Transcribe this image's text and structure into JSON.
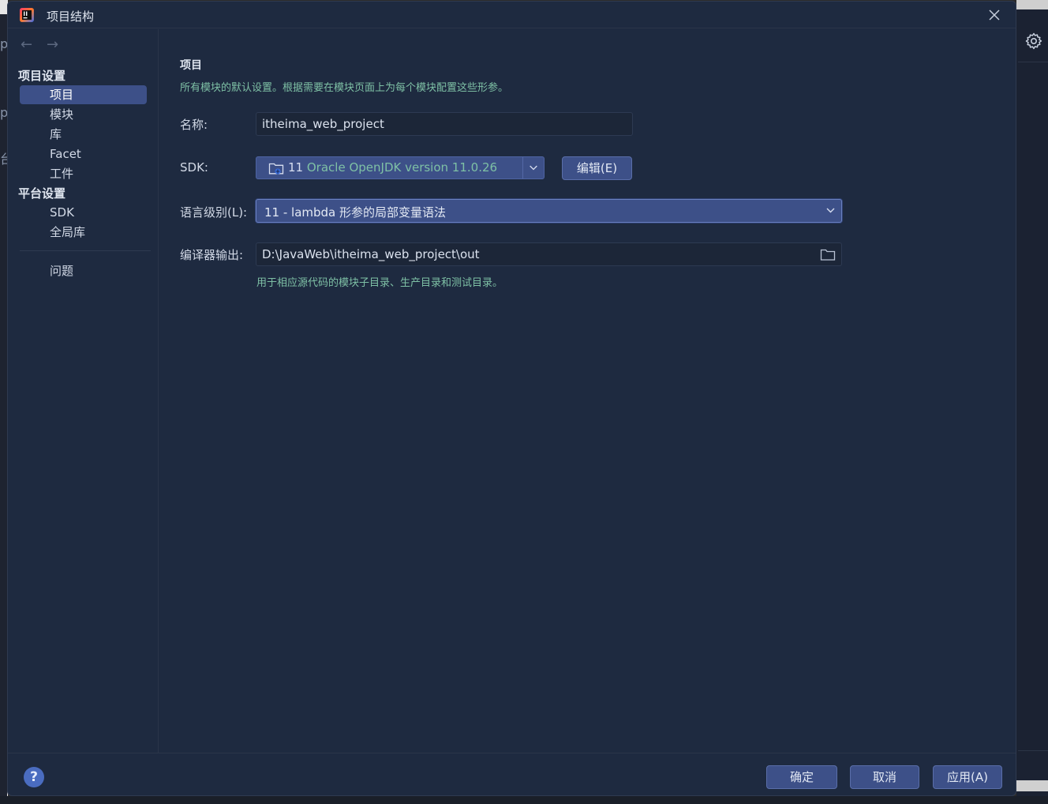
{
  "dialog": {
    "title": "项目结构"
  },
  "background": {
    "left_glyph_1": "p",
    "left_glyph_2": "p",
    "left_glyph_3": "台"
  },
  "sidebar": {
    "back_icon": "←",
    "forward_icon": "→",
    "project_settings_header": "项目设置",
    "project_items": [
      "项目",
      "模块",
      "库",
      "Facet",
      "工件"
    ],
    "platform_settings_header": "平台设置",
    "platform_items": [
      "SDK",
      "全局库"
    ],
    "problems": "问题",
    "selected_index": 0
  },
  "content": {
    "title": "项目",
    "description": "所有模块的默认设置。根据需要在模块页面上为每个模块配置这些形参。",
    "name_label": "名称:",
    "name_value": "itheima_web_project",
    "sdk_label": "SDK:",
    "sdk_version": "11",
    "sdk_name": "Oracle OpenJDK version 11.0.26",
    "edit_button": "编辑(E)",
    "language_level_label": "语言级别(L):",
    "language_level_value": "11 - lambda 形参的局部变量语法",
    "compiler_output_label": "编译器输出:",
    "compiler_output_value": "D:\\JavaWeb\\itheima_web_project\\out",
    "compiler_output_hint": "用于相应源代码的模块子目录、生产目录和测试目录。"
  },
  "footer": {
    "help_icon": "?",
    "ok_button": "确定",
    "cancel_button": "取消",
    "apply_button": "应用(A)"
  },
  "colors": {
    "dialog_bg": "#1e2a40",
    "accent": "#3d5088",
    "hint_text": "#7ec0a5",
    "text": "#d2d9e6"
  }
}
